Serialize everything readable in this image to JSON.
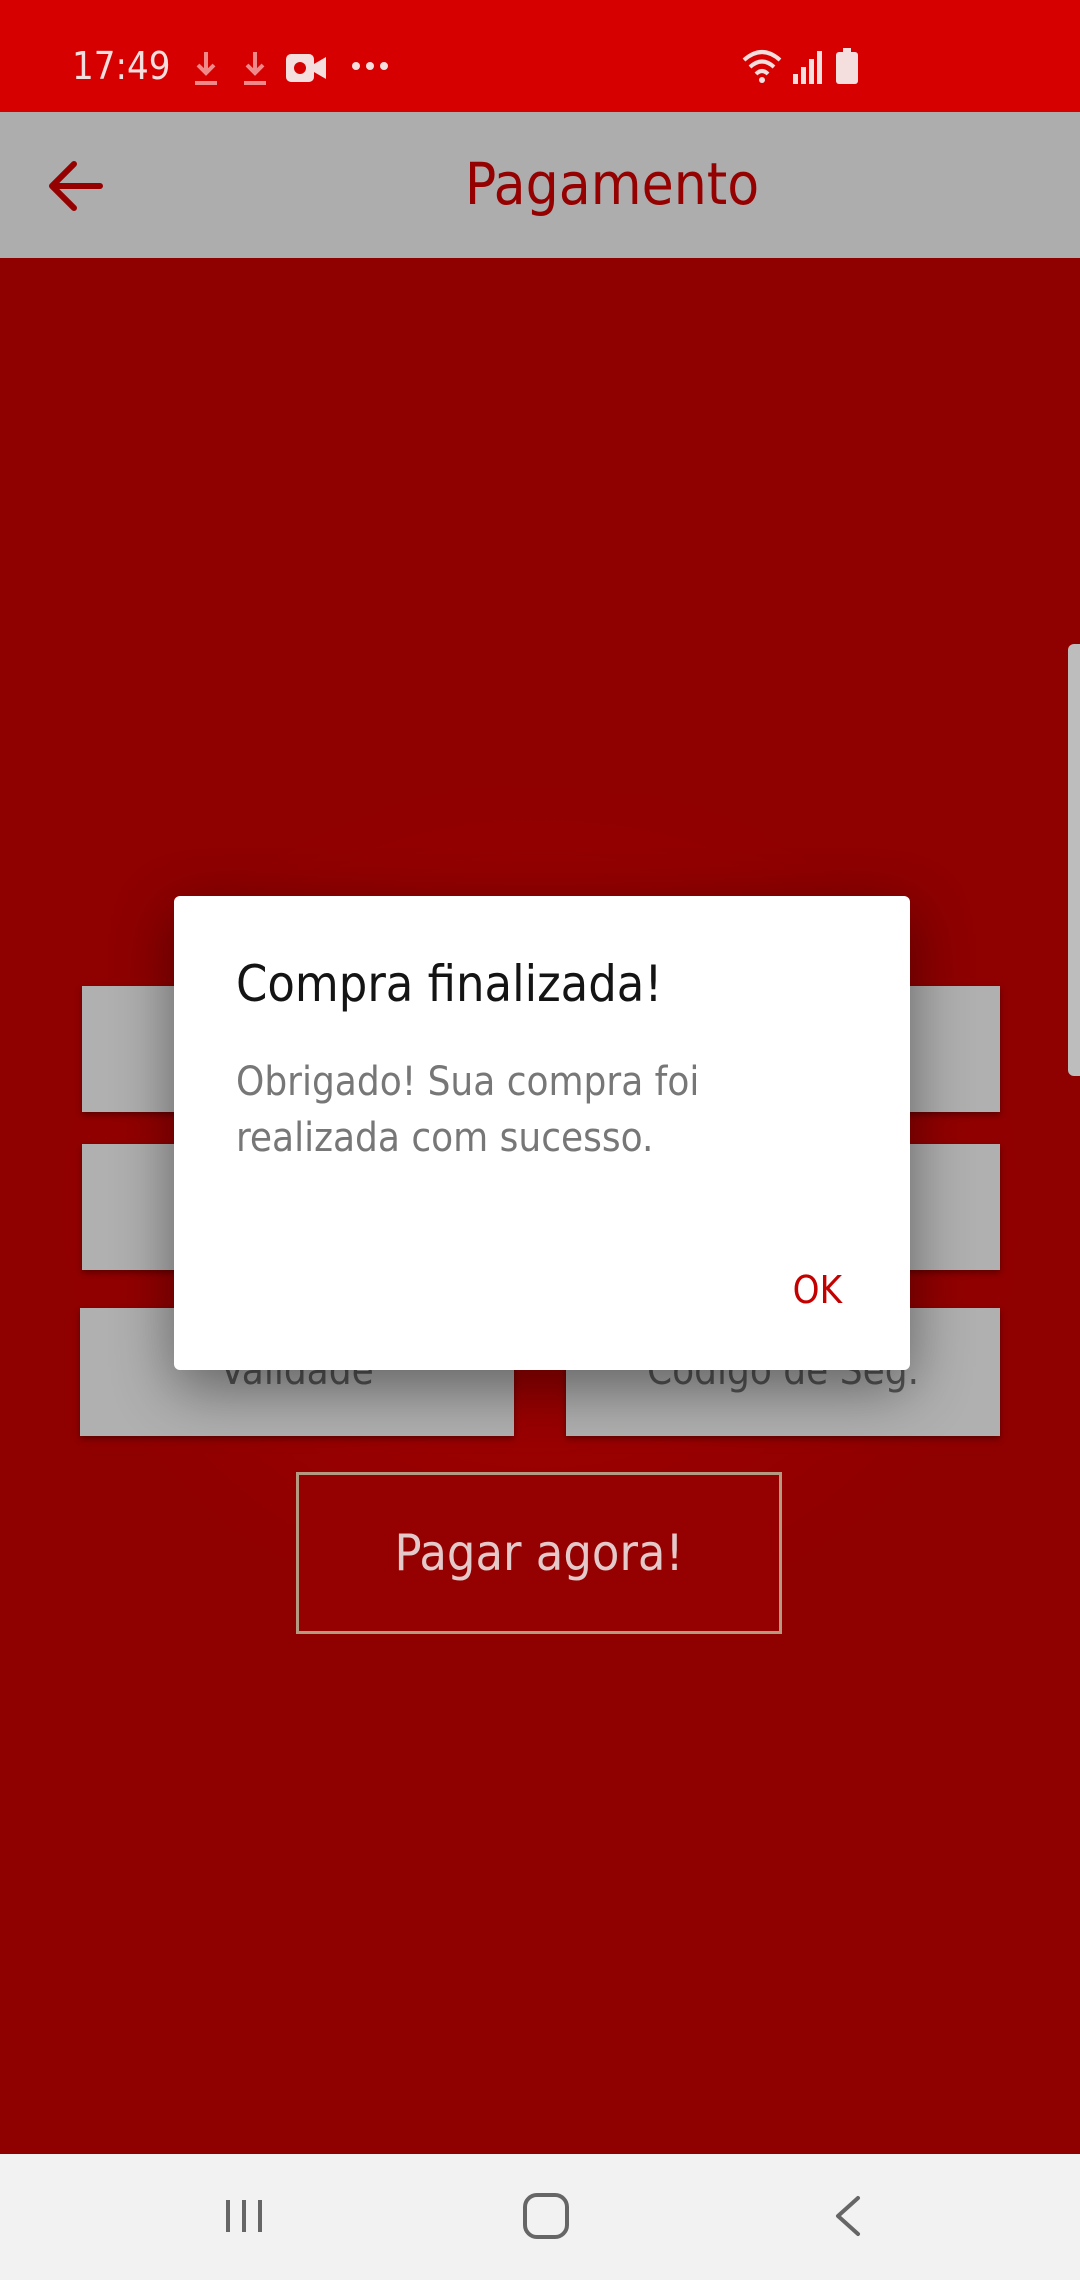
{
  "status_bar": {
    "time": "17:49",
    "icons": [
      "download-icon",
      "download-icon",
      "video-record-icon",
      "more-dots-icon",
      "wifi-icon",
      "cell-signal-icon",
      "battery-icon"
    ]
  },
  "app_bar": {
    "title": "Pagamento",
    "back_icon": "arrow-left-icon"
  },
  "form": {
    "field_1": "",
    "field_2": "",
    "validade_placeholder": "Validade",
    "codigo_placeholder": "Código de Seg.",
    "pay_button": "Pagar agora!"
  },
  "dialog": {
    "title": "Compra finalizada!",
    "message": "Obrigado! Sua compra foi realizada com sucesso.",
    "ok": "OK"
  },
  "nav_bar": {
    "icons": [
      "recents-icon",
      "home-icon",
      "back-icon"
    ]
  },
  "colors": {
    "status_bar": "#d60000",
    "app_bar": "#adadad",
    "background": "#8f0000",
    "accent": "#c40000"
  }
}
